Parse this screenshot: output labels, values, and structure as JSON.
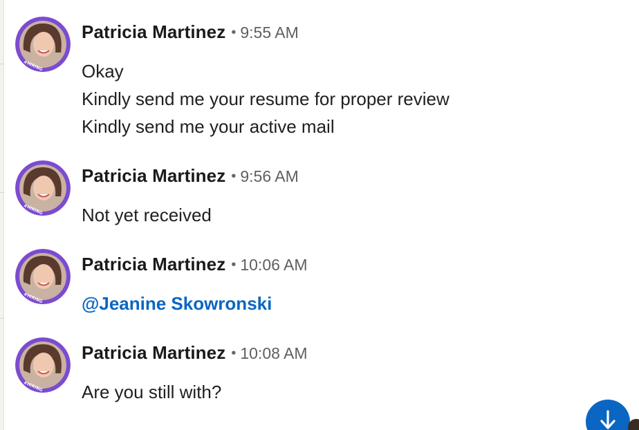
{
  "messages": [
    {
      "sender": "Patricia Martinez",
      "separator": "•",
      "time": "9:55 AM",
      "lines": [
        "Okay",
        "Kindly send me your resume for proper review",
        "Kindly send me your active mail"
      ],
      "badge": "#HIRING"
    },
    {
      "sender": "Patricia Martinez",
      "separator": "•",
      "time": "9:56 AM",
      "lines": [
        "Not yet received"
      ],
      "badge": "#HIRING"
    },
    {
      "sender": "Patricia Martinez",
      "separator": "•",
      "time": "10:06 AM",
      "mention": "@Jeanine Skowronski",
      "badge": "#HIRING"
    },
    {
      "sender": "Patricia Martinez",
      "separator": "•",
      "time": "10:08 AM",
      "lines": [
        "Are you still with?"
      ],
      "badge": "#HIRING"
    }
  ],
  "scroll_button": {
    "icon": "arrow-down-icon"
  },
  "colors": {
    "accent": "#0a66c2",
    "hiring_ring": "#7b4ccf",
    "text": "#1d1d1d",
    "muted": "#5f5f5f"
  }
}
